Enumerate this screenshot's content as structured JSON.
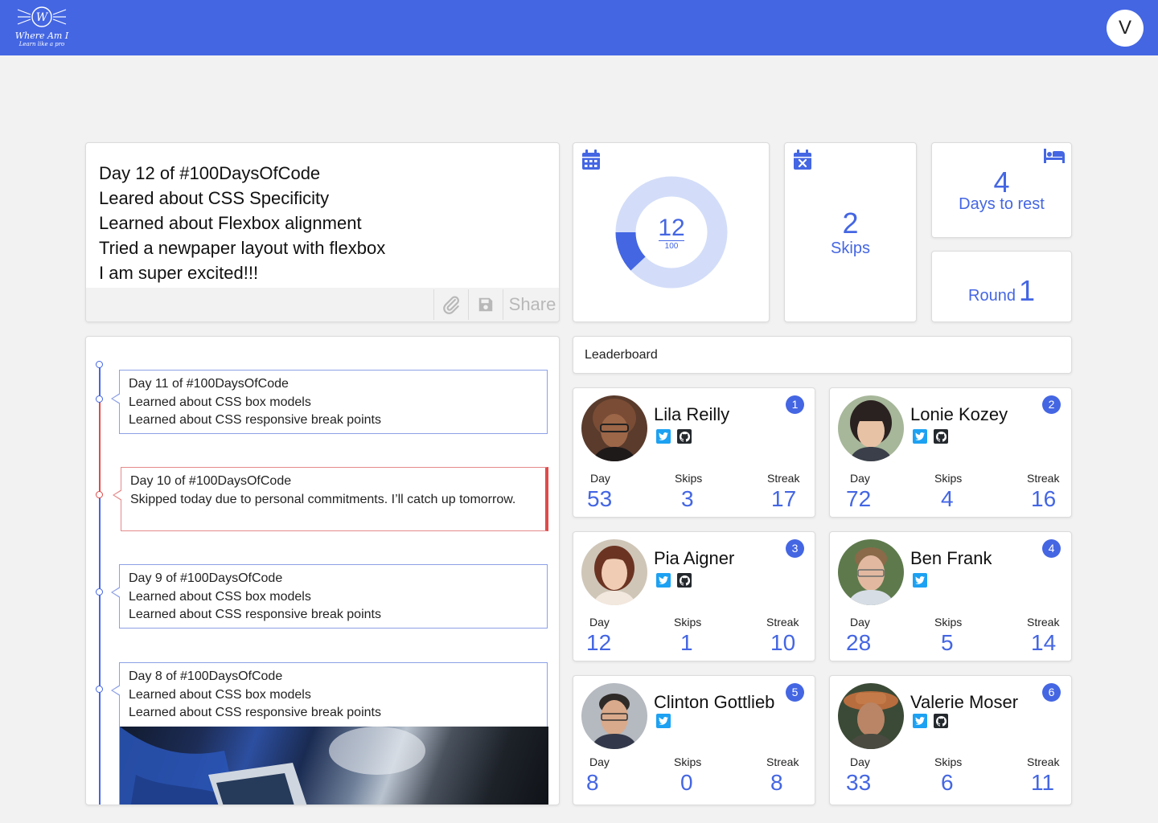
{
  "app": {
    "logo_letter": "W",
    "logo_title": "Where Am I",
    "logo_tagline": "Learn like a pro",
    "user_initial": "V",
    "accent": "#4466e3"
  },
  "composer": {
    "lines": [
      "Day 12 of #100DaysOfCode",
      "Leared about CSS Specificity",
      "Learned about Flexbox alignment",
      "Tried a newpaper layout with flexbox",
      "I am super excited!!!"
    ],
    "share_label": "Share",
    "attach_icon": "paperclip-icon",
    "save_icon": "floppy-disk-icon"
  },
  "stats": {
    "day_progress": {
      "current": "12",
      "total": "100",
      "icon": "calendar-icon",
      "fraction": 0.12
    },
    "skips": {
      "value": "2",
      "label": "Skips",
      "icon": "calendar-x-icon"
    },
    "rest": {
      "value": "4",
      "label": "Days to rest",
      "icon": "bed-icon"
    },
    "round": {
      "label": "Round",
      "value": "1"
    }
  },
  "timeline": {
    "items": [
      {
        "lines": [
          "Day 11 of #100DaysOfCode",
          "Learned about CSS box models",
          "Learned about CSS responsive break points"
        ],
        "status": "done"
      },
      {
        "lines": [
          "Day 10 of #100DaysOfCode",
          "Skipped today due to personal commitments. I’ll catch up tomorrow."
        ],
        "status": "skipped"
      },
      {
        "lines": [
          "Day 9 of #100DaysOfCode",
          "Learned about CSS box models",
          "Learned about CSS responsive break points"
        ],
        "status": "done"
      },
      {
        "lines": [
          "Day 8 of #100DaysOfCode",
          "Learned about CSS box models",
          "Learned about CSS responsive break points"
        ],
        "status": "done",
        "has_image": true
      }
    ]
  },
  "leaderboard": {
    "title": "Leaderboard",
    "labels": {
      "day": "Day",
      "skips": "Skips",
      "streak": "Streak"
    },
    "players": [
      {
        "rank": "1",
        "name": "Lila Reilly",
        "day": "53",
        "skips": "3",
        "streak": "17",
        "twitter": true,
        "github": true
      },
      {
        "rank": "2",
        "name": "Lonie Kozey",
        "day": "72",
        "skips": "4",
        "streak": "16",
        "twitter": true,
        "github": true
      },
      {
        "rank": "3",
        "name": "Pia Aigner",
        "day": "12",
        "skips": "1",
        "streak": "10",
        "twitter": true,
        "github": true
      },
      {
        "rank": "4",
        "name": "Ben Frank",
        "day": "28",
        "skips": "5",
        "streak": "14",
        "twitter": true,
        "github": false
      },
      {
        "rank": "5",
        "name": "Clinton Gottlieb",
        "day": "8",
        "skips": "0",
        "streak": "8",
        "twitter": true,
        "github": false
      },
      {
        "rank": "6",
        "name": "Valerie Moser",
        "day": "33",
        "skips": "6",
        "streak": "11",
        "twitter": true,
        "github": true
      }
    ]
  }
}
